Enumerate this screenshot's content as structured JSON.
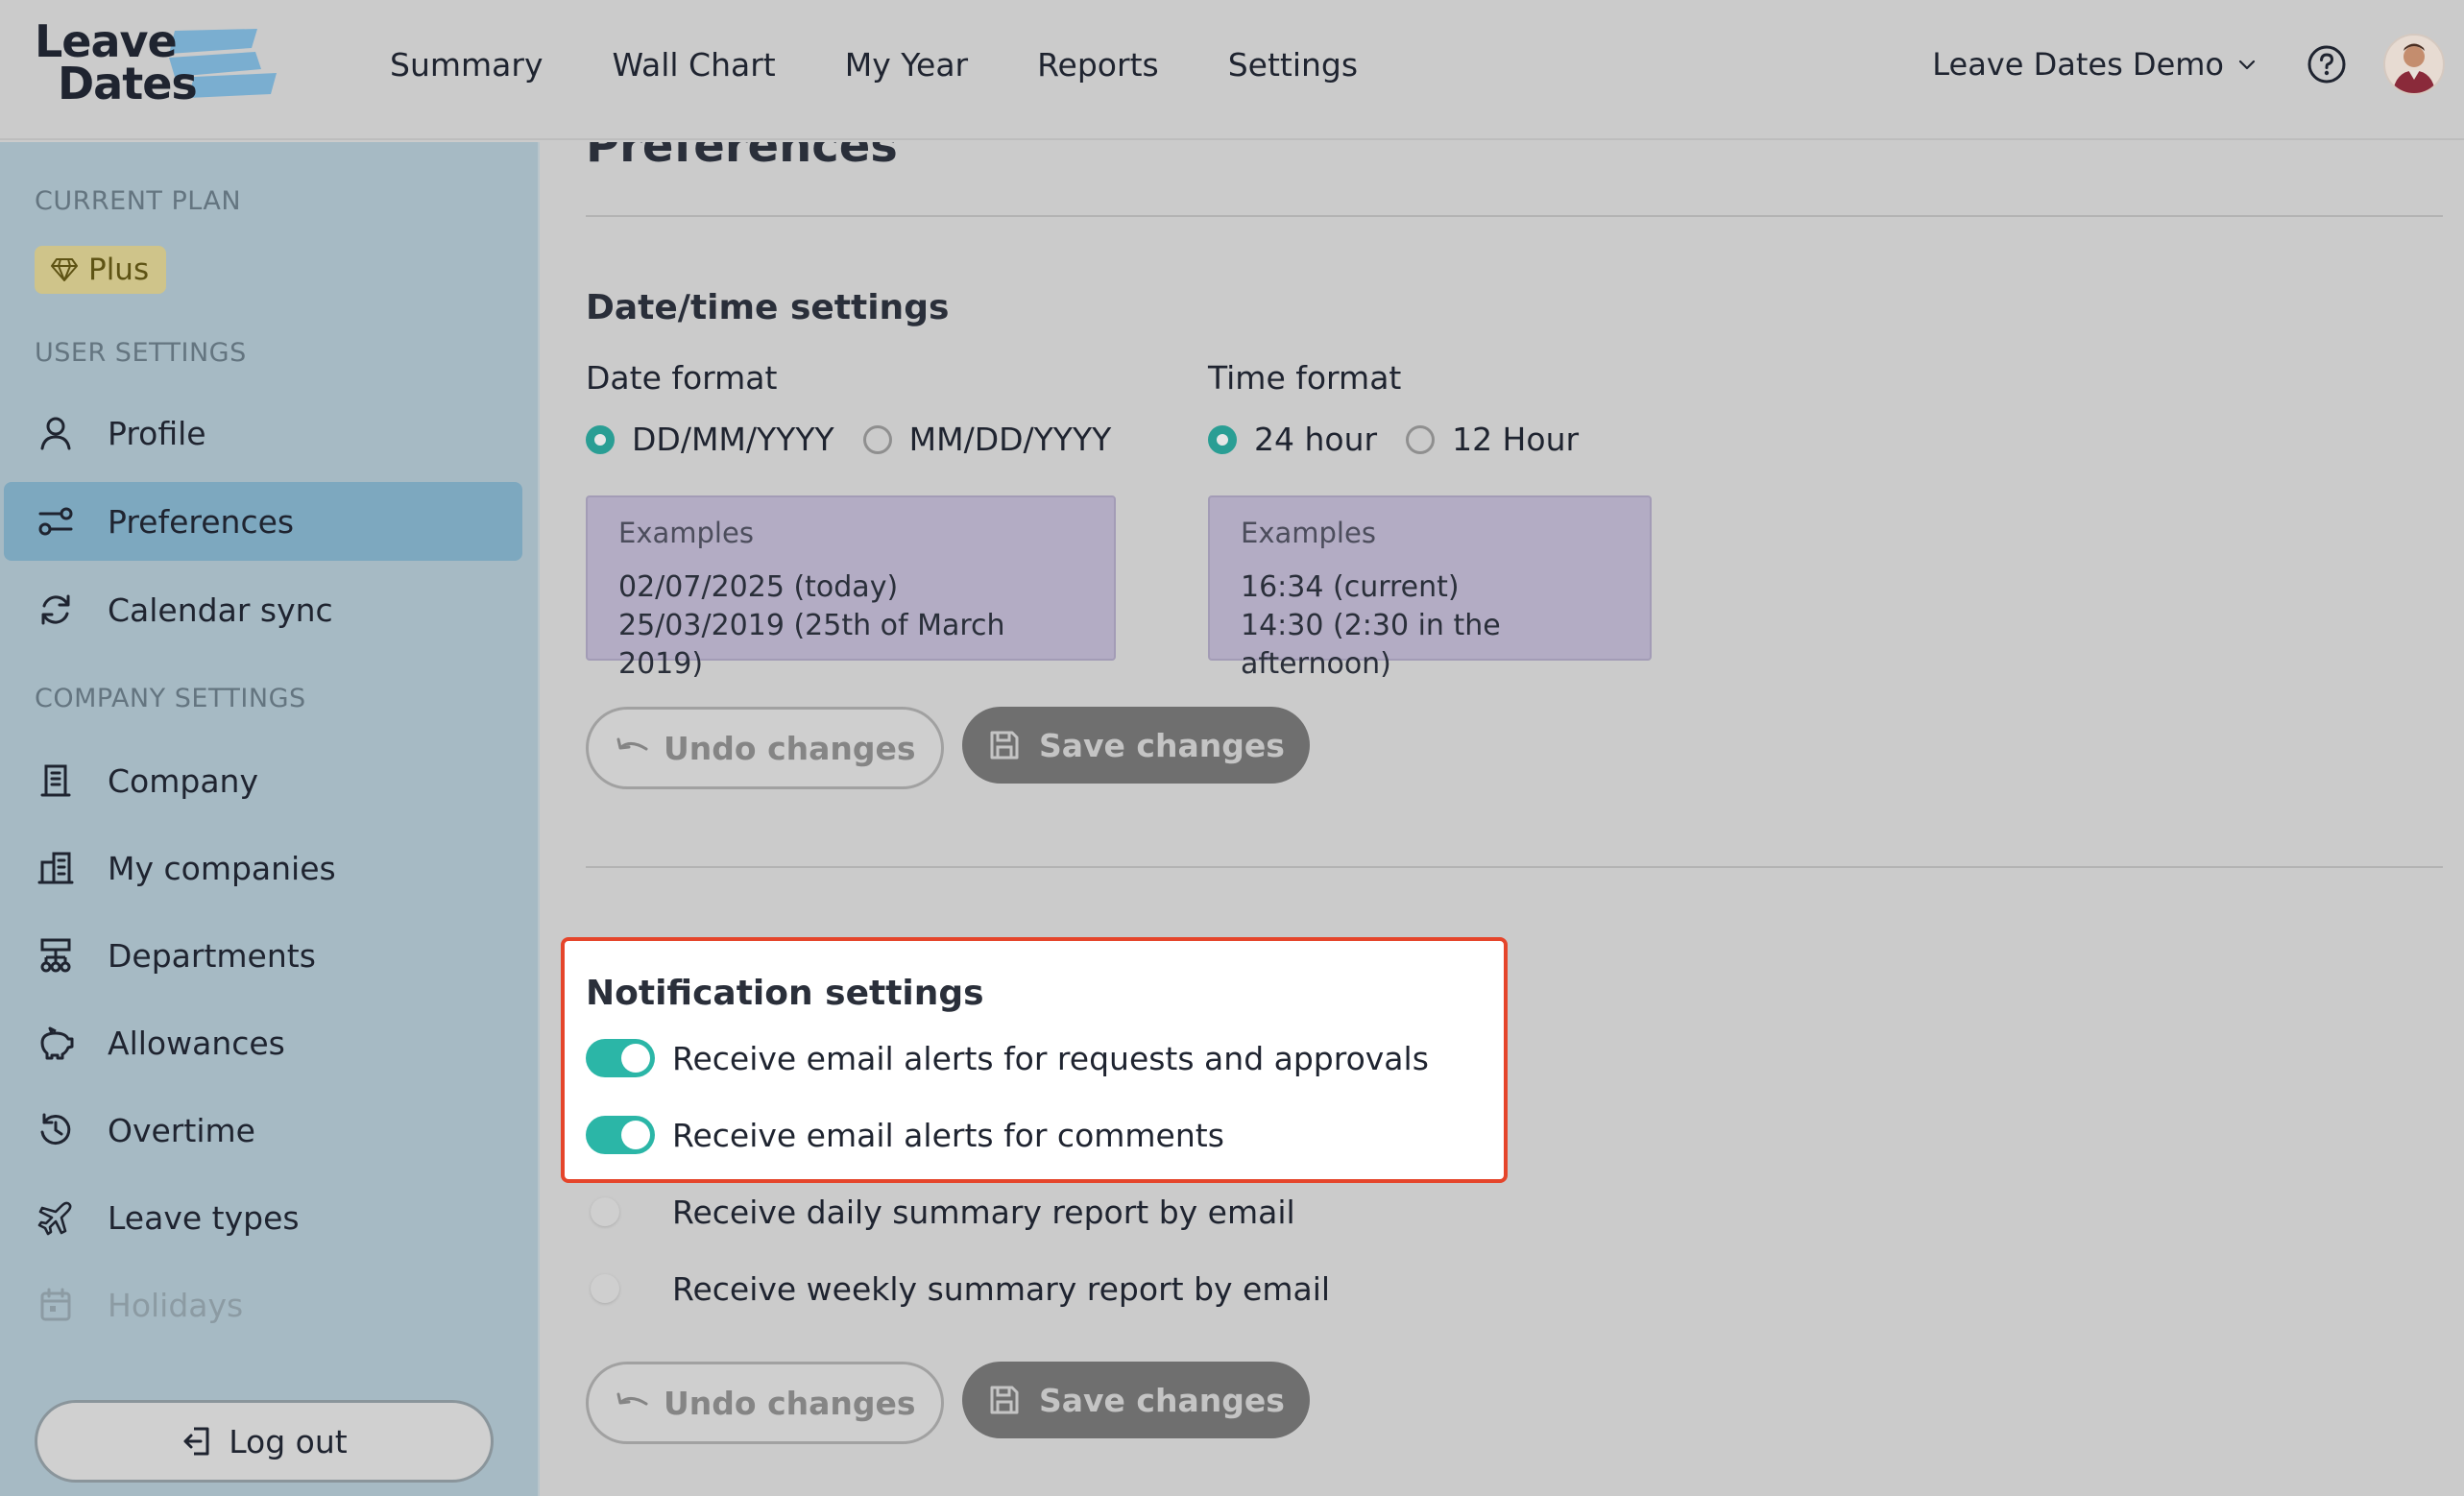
{
  "app": {
    "logo_line1": "Leave",
    "logo_line2": "Dates",
    "accent": "#2bb6a7",
    "logo_brush": "#7aaed0"
  },
  "nav": {
    "items": [
      "Summary",
      "Wall Chart",
      "My Year",
      "Reports",
      "Settings"
    ]
  },
  "header": {
    "company_name": "Leave Dates Demo",
    "help_icon": "question-circle-icon",
    "avatar_icon": "user-avatar"
  },
  "sidebar": {
    "current_plan_heading": "CURRENT PLAN",
    "plan_badge": "Plus",
    "user_settings_heading": "USER SETTINGS",
    "user_items": [
      {
        "label": "Profile",
        "icon": "user-icon"
      },
      {
        "label": "Preferences",
        "icon": "sliders-icon",
        "active": true
      },
      {
        "label": "Calendar sync",
        "icon": "sync-icon"
      }
    ],
    "company_settings_heading": "COMPANY SETTINGS",
    "company_items": [
      {
        "label": "Company",
        "icon": "building-icon"
      },
      {
        "label": "My companies",
        "icon": "buildings-icon"
      },
      {
        "label": "Departments",
        "icon": "hierarchy-icon"
      },
      {
        "label": "Allowances",
        "icon": "piggy-bank-icon"
      },
      {
        "label": "Overtime",
        "icon": "clock-history-icon"
      },
      {
        "label": "Leave types",
        "icon": "plane-icon"
      },
      {
        "label": "Holidays",
        "icon": "calendar-icon"
      }
    ],
    "logout_label": "Log out"
  },
  "main": {
    "page_title": "Preferences",
    "datetime": {
      "title": "Date/time settings",
      "date_format_label": "Date format",
      "date_options": [
        "DD/MM/YYYY",
        "MM/DD/YYYY"
      ],
      "date_selected": "DD/MM/YYYY",
      "date_examples_label": "Examples",
      "date_examples": [
        "02/07/2025 (today)",
        "25/03/2019 (25th of March 2019)"
      ],
      "time_format_label": "Time format",
      "time_options": [
        "24 hour",
        "12 Hour"
      ],
      "time_selected": "24 hour",
      "time_examples_label": "Examples",
      "time_examples": [
        "16:34 (current)",
        "14:30 (2:30 in the afternoon)"
      ],
      "undo_label": "Undo changes",
      "save_label": "Save changes"
    },
    "notifications": {
      "title": "Notification settings",
      "toggles": [
        {
          "label": "Receive email alerts for requests and approvals",
          "on": true
        },
        {
          "label": "Receive email alerts for comments",
          "on": true
        },
        {
          "label": "Receive daily summary report by email",
          "on": false
        },
        {
          "label": "Receive weekly summary report by email",
          "on": false
        }
      ],
      "undo_label": "Undo changes",
      "save_label": "Save changes",
      "highlight_color": "#e5452b"
    }
  }
}
